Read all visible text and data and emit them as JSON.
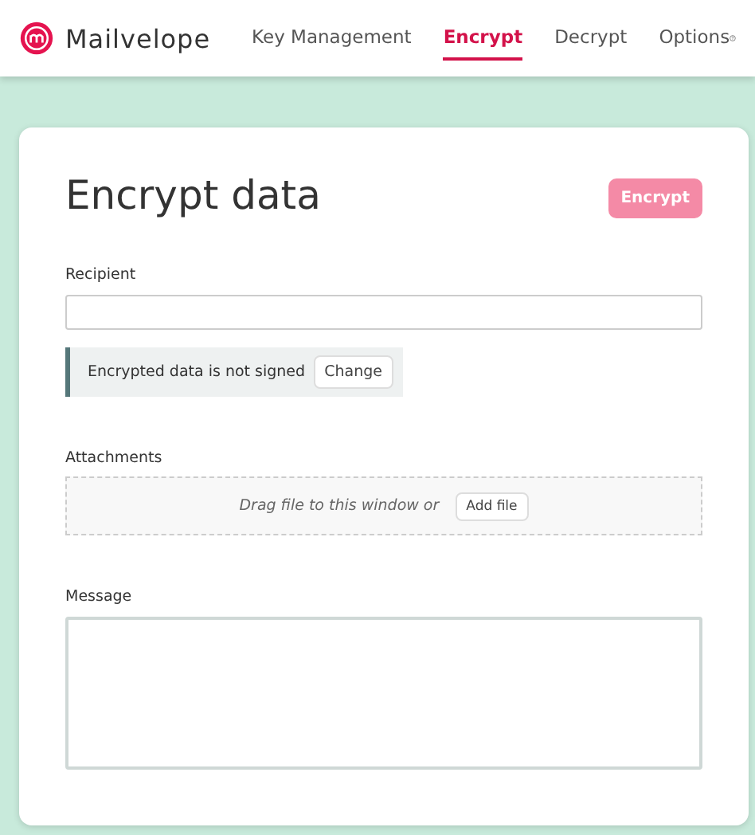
{
  "app": {
    "name": "Mailvelope"
  },
  "nav": [
    {
      "label": "Key Management",
      "selected": false
    },
    {
      "label": "Encrypt",
      "selected": true
    },
    {
      "label": "Decrypt",
      "selected": false
    },
    {
      "label": "Options",
      "selected": false
    }
  ],
  "page": {
    "title": "Encrypt data",
    "action": {
      "label": "Encrypt",
      "disabled": true
    }
  },
  "recipient": {
    "label": "Recipient"
  },
  "signature": {
    "text": "Encrypted data is not signed",
    "button": "Change"
  },
  "attachments": {
    "label": "Attachments",
    "hint": "Drag file to this window or",
    "button": "Add file"
  },
  "message": {
    "label": "Message"
  }
}
